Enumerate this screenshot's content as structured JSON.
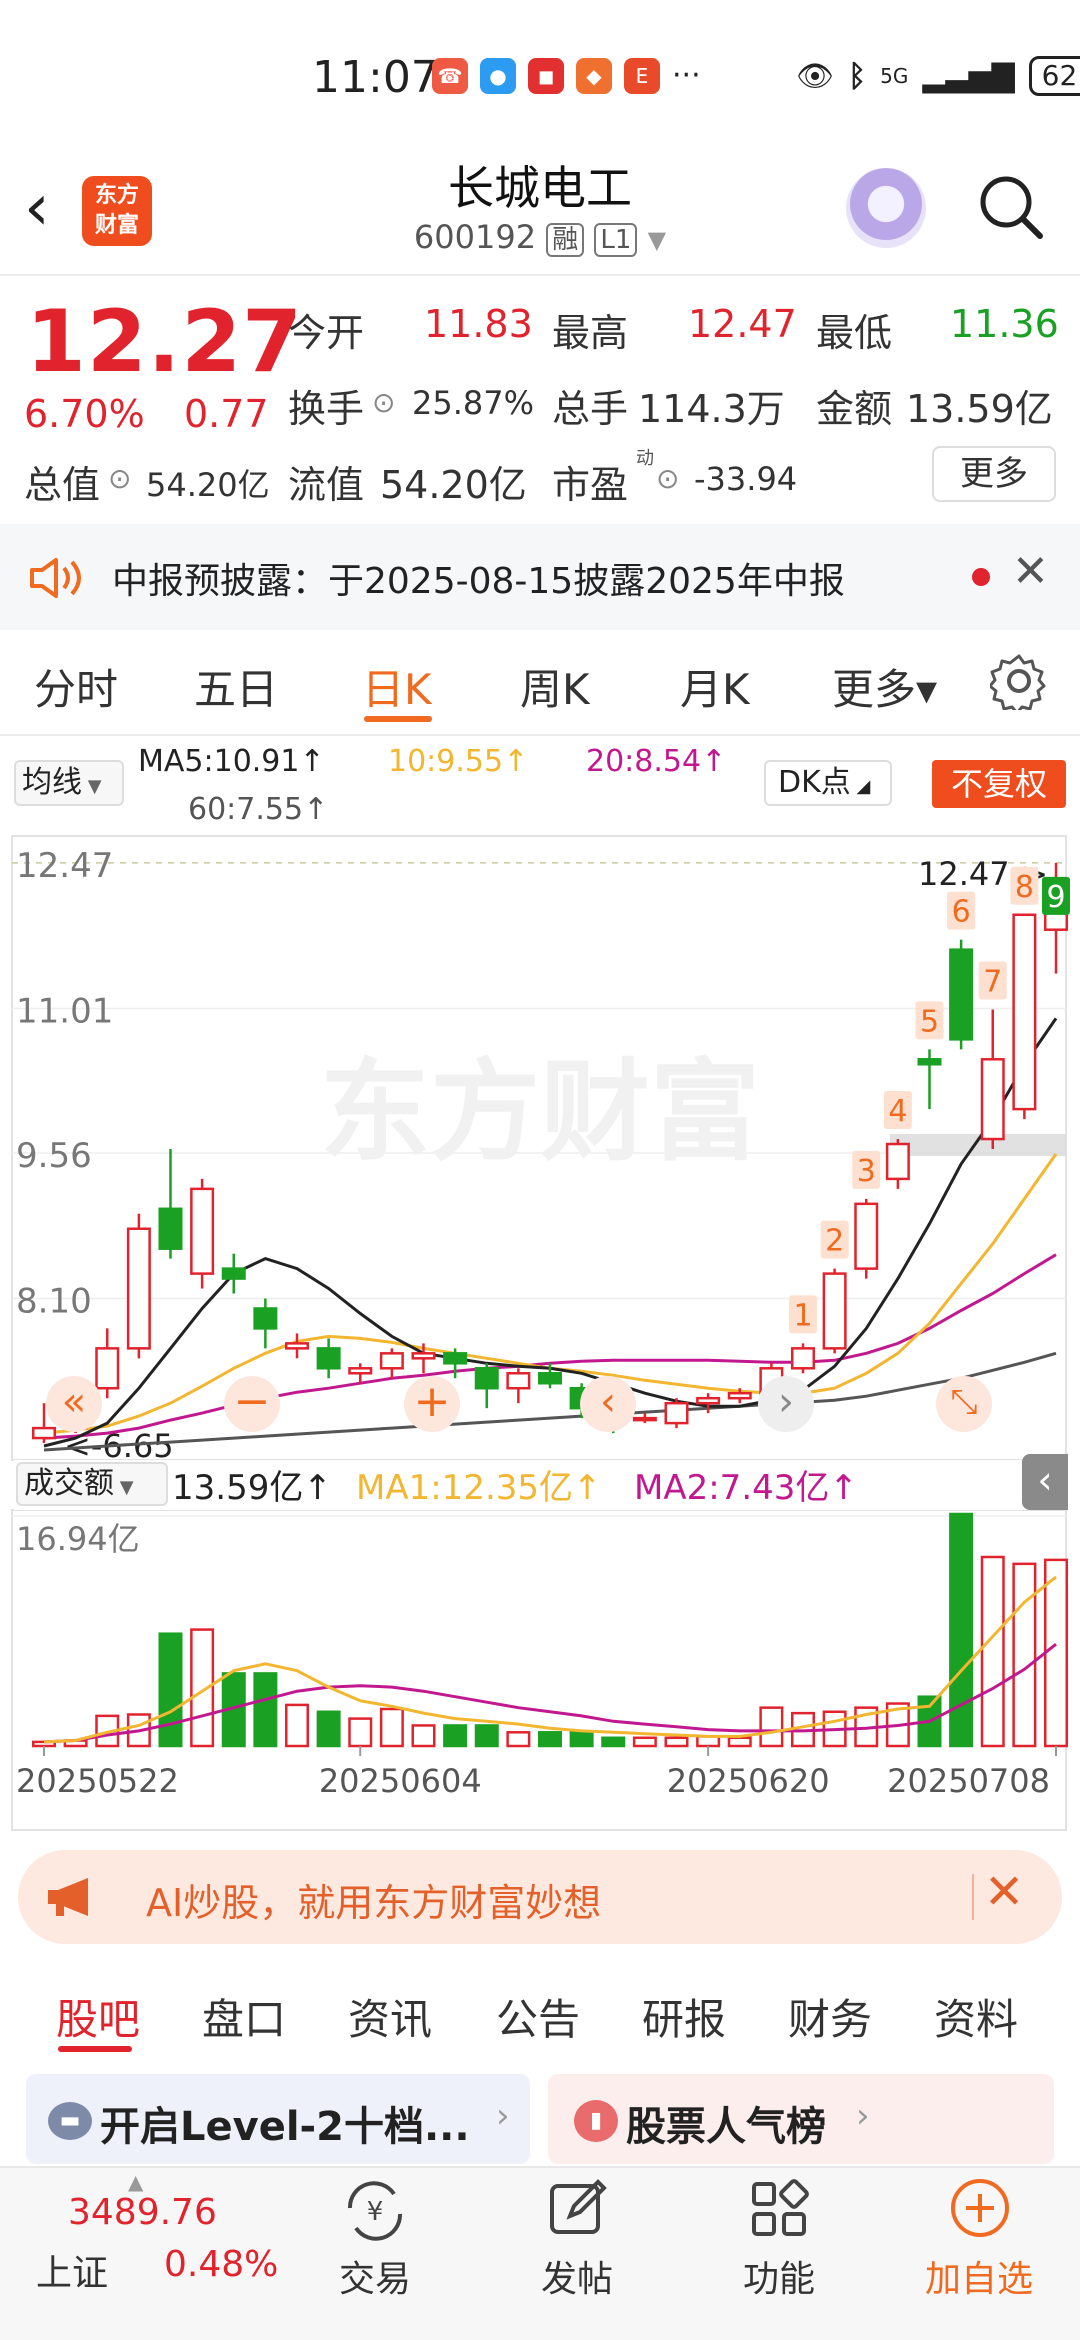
{
  "status": {
    "time": "11:07",
    "more": "···",
    "network": "5G",
    "battery": "62"
  },
  "header": {
    "back": "‹",
    "logo": "东方\n财富",
    "stock_name": "长城电工",
    "code": "600192",
    "tag_rong": "融",
    "tag_level": "L1"
  },
  "quote": {
    "price": "12.27",
    "change_pct": "6.70%",
    "change": "0.77",
    "open_label": "今开",
    "open": "11.83",
    "high_label": "最高",
    "high": "12.47",
    "low_label": "最低",
    "low": "11.36",
    "turnover_label": "换手",
    "turnover": "25.87%",
    "volume_label": "总手",
    "volume": "114.3万",
    "amount_label": "金额",
    "amount": "13.59亿",
    "mcap_label": "总值",
    "mcap": "54.20亿",
    "float_label": "流值",
    "float_mcap": "54.20亿",
    "pe_label": "市盈",
    "pe_sup": "动",
    "pe": "-33.94",
    "more_label": "更多"
  },
  "notice": {
    "text": "中报预披露：于2025-08-15披露2025年中报"
  },
  "period_tabs": [
    {
      "label": "分时"
    },
    {
      "label": "五日"
    },
    {
      "label": "日K"
    },
    {
      "label": "周K"
    },
    {
      "label": "月K"
    },
    {
      "label": "更多▾"
    }
  ],
  "ma_bar": {
    "select": "均线",
    "ma5": "MA5:10.91↑",
    "ma10": "10:9.55↑",
    "ma20": "20:8.54↑",
    "ma60": "60:7.55↑",
    "dk": "DK点",
    "fq": "不复权"
  },
  "colors": {
    "up": "#e0232c",
    "down": "#1aa023",
    "ma5": "#222222",
    "ma10": "#f2b630",
    "ma20": "#c2188f",
    "ma60": "#555555",
    "accent": "#f06a1f"
  },
  "chart_labels": {
    "y_ticks": [
      "12.47",
      "11.01",
      "9.56",
      "8.10"
    ],
    "max_marker": "12.47->",
    "min_marker": "<-6.65",
    "watermark": "东方财富",
    "seq_marks": [
      "1",
      "2",
      "3",
      "4",
      "5",
      "6",
      "7",
      "8",
      "9"
    ]
  },
  "volume_bar": {
    "select": "成交额",
    "total": "13.59亿↑",
    "ma1": "MA1:12.35亿↑",
    "ma2": "MA2:7.43亿↑",
    "y_max": "16.94亿"
  },
  "chart_data": {
    "type": "candlestick",
    "x_labels": [
      "20250522",
      "20250604",
      "20250620",
      "20250708"
    ],
    "ohlc": [
      [
        6.7,
        7.05,
        6.65,
        6.8
      ],
      [
        6.8,
        7.05,
        6.75,
        6.95
      ],
      [
        7.2,
        7.8,
        7.1,
        7.6
      ],
      [
        7.6,
        8.95,
        7.5,
        8.8
      ],
      [
        9.0,
        9.6,
        8.5,
        8.6
      ],
      [
        8.35,
        9.3,
        8.2,
        9.2
      ],
      [
        8.4,
        8.55,
        8.15,
        8.3
      ],
      [
        8.0,
        8.1,
        7.6,
        7.8
      ],
      [
        7.6,
        7.75,
        7.5,
        7.65
      ],
      [
        7.6,
        7.7,
        7.3,
        7.4
      ],
      [
        7.35,
        7.45,
        7.25,
        7.4
      ],
      [
        7.4,
        7.6,
        7.3,
        7.55
      ],
      [
        7.5,
        7.65,
        7.35,
        7.55
      ],
      [
        7.55,
        7.6,
        7.3,
        7.45
      ],
      [
        7.4,
        7.45,
        7.0,
        7.2
      ],
      [
        7.2,
        7.4,
        7.05,
        7.35
      ],
      [
        7.35,
        7.45,
        7.2,
        7.25
      ],
      [
        7.2,
        7.25,
        6.9,
        7.0
      ],
      [
        6.95,
        7.0,
        6.75,
        6.85
      ],
      [
        6.9,
        6.95,
        6.85,
        6.9
      ],
      [
        6.85,
        7.1,
        6.8,
        7.05
      ],
      [
        7.05,
        7.15,
        6.95,
        7.1
      ],
      [
        7.1,
        7.2,
        7.05,
        7.15
      ],
      [
        7.15,
        7.45,
        7.1,
        7.4
      ],
      [
        7.4,
        7.65,
        7.35,
        7.6
      ],
      [
        7.6,
        8.4,
        7.55,
        8.35
      ],
      [
        8.4,
        9.1,
        8.3,
        9.05
      ],
      [
        9.3,
        9.7,
        9.2,
        9.65
      ],
      [
        10.5,
        10.6,
        10.0,
        10.45
      ],
      [
        11.6,
        11.7,
        10.6,
        10.7
      ],
      [
        9.7,
        11.0,
        9.6,
        10.5
      ],
      [
        10.0,
        11.95,
        9.9,
        11.95
      ],
      [
        11.8,
        12.47,
        11.36,
        12.27
      ]
    ],
    "ma5": [
      6.62,
      6.7,
      6.85,
      7.2,
      7.6,
      8.0,
      8.35,
      8.5,
      8.4,
      8.2,
      7.95,
      7.72,
      7.55,
      7.5,
      7.45,
      7.42,
      7.4,
      7.35,
      7.25,
      7.15,
      7.07,
      7.02,
      7.02,
      7.08,
      7.18,
      7.42,
      7.8,
      8.3,
      8.85,
      9.45,
      9.9,
      10.45,
      10.91
    ],
    "ma10": [
      6.75,
      6.78,
      6.82,
      6.92,
      7.05,
      7.22,
      7.4,
      7.55,
      7.67,
      7.72,
      7.7,
      7.66,
      7.6,
      7.55,
      7.5,
      7.45,
      7.4,
      7.37,
      7.33,
      7.28,
      7.24,
      7.2,
      7.17,
      7.15,
      7.15,
      7.2,
      7.35,
      7.55,
      7.85,
      8.25,
      8.65,
      9.1,
      9.55
    ],
    "ma20": [
      6.7,
      6.72,
      6.75,
      6.8,
      6.88,
      6.95,
      7.03,
      7.1,
      7.16,
      7.2,
      7.25,
      7.3,
      7.33,
      7.37,
      7.4,
      7.42,
      7.45,
      7.47,
      7.48,
      7.48,
      7.48,
      7.48,
      7.47,
      7.46,
      7.46,
      7.48,
      7.55,
      7.65,
      7.8,
      7.98,
      8.15,
      8.35,
      8.54
    ],
    "ma60": [
      6.58,
      6.6,
      6.62,
      6.64,
      6.66,
      6.68,
      6.7,
      6.72,
      6.74,
      6.76,
      6.78,
      6.8,
      6.82,
      6.84,
      6.86,
      6.88,
      6.9,
      6.92,
      6.94,
      6.96,
      6.98,
      7.0,
      7.02,
      7.04,
      7.06,
      7.08,
      7.12,
      7.18,
      7.24,
      7.3,
      7.38,
      7.46,
      7.55
    ],
    "amount": [
      0.3,
      0.4,
      2.2,
      2.3,
      8.2,
      8.5,
      5.3,
      5.3,
      3.0,
      2.5,
      2.0,
      2.7,
      1.5,
      1.5,
      1.5,
      1.0,
      1.0,
      1.0,
      0.6,
      0.6,
      0.6,
      0.7,
      0.6,
      2.8,
      2.4,
      2.5,
      2.8,
      3.1,
      3.6,
      16.94,
      13.8,
      13.3,
      13.59
    ],
    "amount_ma1": [
      0.3,
      0.4,
      1.0,
      1.5,
      2.5,
      4.0,
      5.5,
      6.0,
      5.5,
      4.3,
      3.3,
      2.9,
      2.4,
      2.0,
      1.8,
      1.6,
      1.3,
      1.1,
      1.0,
      0.9,
      0.8,
      0.7,
      0.7,
      1.0,
      1.4,
      1.8,
      2.3,
      2.7,
      2.9,
      5.5,
      8.0,
      10.5,
      12.35
    ],
    "amount_ma2": [
      0.3,
      0.4,
      0.8,
      1.1,
      1.6,
      2.2,
      2.8,
      3.4,
      4.0,
      4.3,
      4.4,
      4.3,
      4.0,
      3.6,
      3.2,
      2.8,
      2.5,
      2.2,
      1.8,
      1.6,
      1.4,
      1.2,
      1.1,
      1.1,
      1.1,
      1.2,
      1.3,
      1.5,
      1.8,
      3.0,
      4.2,
      5.6,
      7.43
    ],
    "price_range": [
      6.5,
      12.7
    ],
    "amount_range": [
      0,
      16.94
    ]
  },
  "ai_banner": {
    "text": "AI炒股，就用东方财富妙想"
  },
  "bottom_tabs": [
    {
      "label": "股吧"
    },
    {
      "label": "盘口"
    },
    {
      "label": "资讯"
    },
    {
      "label": "公告"
    },
    {
      "label": "研报"
    },
    {
      "label": "财务"
    },
    {
      "label": "资料"
    }
  ],
  "cards": {
    "left": "开启Level-2十档...",
    "right": "股票人气榜"
  },
  "index": {
    "value": "3489.76",
    "name": "上证",
    "pct": "0.48%"
  },
  "nav": [
    {
      "label": "交易"
    },
    {
      "label": "发帖"
    },
    {
      "label": "功能"
    },
    {
      "label": "加自选"
    }
  ]
}
